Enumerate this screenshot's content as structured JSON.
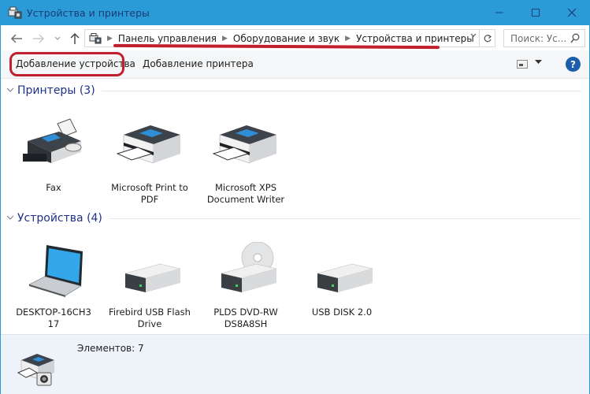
{
  "window": {
    "title": "Устройства и принтеры",
    "controls": {
      "minimize": "—",
      "maximize": "☐",
      "close": "✕"
    },
    "accent_color": "#2b9bd8"
  },
  "navigation": {
    "back": "←",
    "forward": "→",
    "recent": "⌄",
    "up": "↑",
    "breadcrumbs": [
      "Панель управления",
      "Оборудование и звук",
      "Устройства и принтеры"
    ],
    "refresh": "↻",
    "search_placeholder": "Поиск: Ус..."
  },
  "toolbar": {
    "add_device": "Добавление устройства",
    "add_printer": "Добавление принтера",
    "help": "?"
  },
  "groups": {
    "printers": {
      "title": "Принтеры (3)",
      "items": [
        {
          "label": "Fax",
          "icon": "fax-icon"
        },
        {
          "label": "Microsoft Print to PDF",
          "icon": "printer-icon"
        },
        {
          "label": "Microsoft XPS Document Writer",
          "icon": "printer-icon"
        }
      ]
    },
    "devices": {
      "title": "Устройства (4)",
      "items": [
        {
          "label": "DESKTOP-16CH3 17",
          "icon": "laptop-icon"
        },
        {
          "label": "Firebird USB Flash Drive",
          "icon": "drive-icon"
        },
        {
          "label": "PLDS DVD-RW DS8A8SH",
          "icon": "dvd-drive-icon"
        },
        {
          "label": "USB DISK 2.0",
          "icon": "drive-icon"
        }
      ]
    }
  },
  "status": {
    "items_count": "Элементов: 7"
  },
  "annotations": {
    "highlight_color": "#c0202e"
  }
}
